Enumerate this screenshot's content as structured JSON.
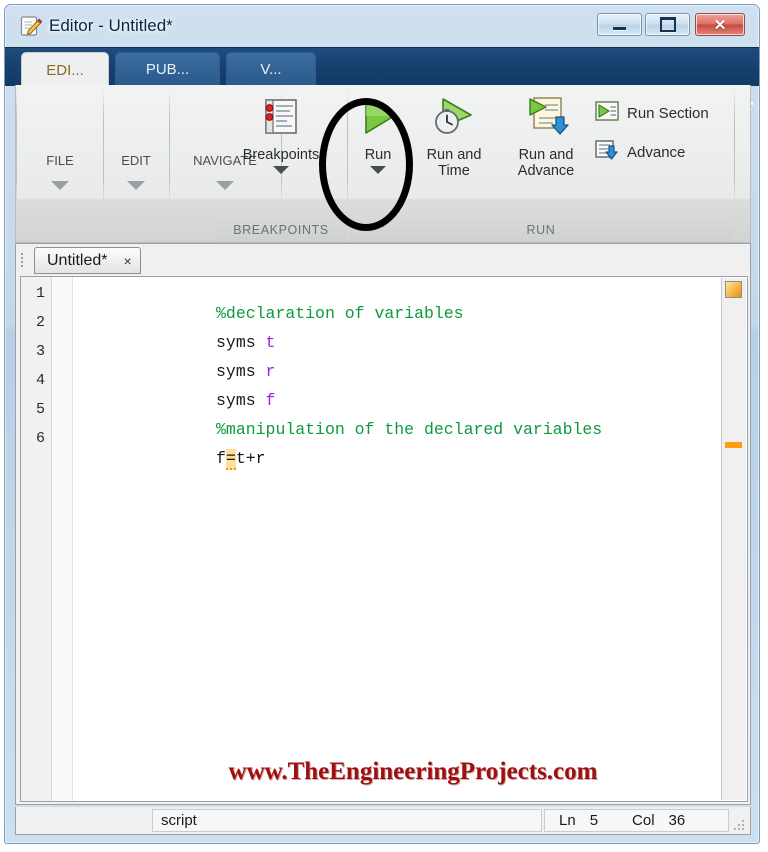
{
  "window": {
    "title": "Editor - Untitled*",
    "icon": "editor-document-pencil-icon",
    "controls": {
      "minimize": "Minimize",
      "maximize": "Maximize",
      "close": "Close",
      "close_glyph": "✕"
    }
  },
  "ribbon": {
    "tabs": [
      {
        "label": "EDI...",
        "active": true
      },
      {
        "label": "PUB...",
        "active": false
      },
      {
        "label": "V...",
        "active": false
      }
    ],
    "quick_access": [
      {
        "name": "new-script-icon",
        "enabled": true
      },
      {
        "name": "save-icon",
        "enabled": true
      },
      {
        "name": "cut-scissors-icon",
        "enabled": false
      },
      {
        "name": "copy-icon",
        "enabled": false
      },
      {
        "name": "paste-icon",
        "enabled": false
      },
      {
        "name": "undo-icon",
        "enabled": true
      },
      {
        "name": "redo-icon",
        "enabled": false
      },
      {
        "name": "windows-cascade-icon",
        "enabled": true
      },
      {
        "name": "help-question-icon",
        "enabled": true
      }
    ],
    "quick_access_dropdown": "customize-quick-access-icon",
    "minimize_ribbon": "minimize-ribbon-icon",
    "collapsed_groups": [
      {
        "label": "FILE"
      },
      {
        "label": "EDIT"
      },
      {
        "label": "NAVIGATE"
      }
    ],
    "groups": [
      {
        "footer": "BREAKPOINTS",
        "buttons": [
          {
            "label": "Breakpoints",
            "icon": "breakpoints-icon",
            "has_dropdown": true
          }
        ]
      },
      {
        "footer": "RUN",
        "buttons": [
          {
            "label": "Run",
            "icon": "run-green-triangle-icon",
            "has_dropdown": true
          },
          {
            "label": "Run and\nTime",
            "icon": "run-and-time-icon",
            "has_dropdown": false
          },
          {
            "label": "Run and\nAdvance",
            "icon": "run-and-advance-icon",
            "has_dropdown": false
          }
        ],
        "small_buttons": [
          {
            "label": "Run Section",
            "icon": "run-section-icon"
          },
          {
            "label": "Advance",
            "icon": "advance-icon"
          }
        ]
      }
    ],
    "annotation": {
      "shape": "ellipse",
      "color": "#000000",
      "targets": "Run"
    }
  },
  "editor": {
    "document_tab": {
      "label": "Untitled*",
      "close_glyph": "×"
    },
    "lines": [
      {
        "num": "1",
        "tokens": [
          {
            "text": "%declaration of variables",
            "type": "comment"
          }
        ]
      },
      {
        "num": "2",
        "tokens": [
          {
            "text": "syms ",
            "type": "plain"
          },
          {
            "text": "t",
            "type": "arg"
          }
        ]
      },
      {
        "num": "3",
        "tokens": [
          {
            "text": "syms ",
            "type": "plain"
          },
          {
            "text": "r",
            "type": "arg"
          }
        ]
      },
      {
        "num": "4",
        "tokens": [
          {
            "text": "syms ",
            "type": "plain"
          },
          {
            "text": "f",
            "type": "arg"
          }
        ]
      },
      {
        "num": "5",
        "tokens": [
          {
            "text": "%manipulation of the declared variables",
            "type": "comment"
          }
        ]
      },
      {
        "num": "6",
        "tokens": [
          {
            "text": "f",
            "type": "plain"
          },
          {
            "text": "=",
            "type": "warnmark"
          },
          {
            "text": "t+r",
            "type": "plain"
          }
        ]
      }
    ],
    "analyzer": {
      "flag": "code-analyzer-warning-icon",
      "mark_color": "#ff9c16"
    },
    "watermark": "www.TheEngineeringProjects.com"
  },
  "statusbar": {
    "file_type": "script",
    "line_label": "Ln",
    "line_value": "5",
    "col_label": "Col",
    "col_value": "36"
  }
}
